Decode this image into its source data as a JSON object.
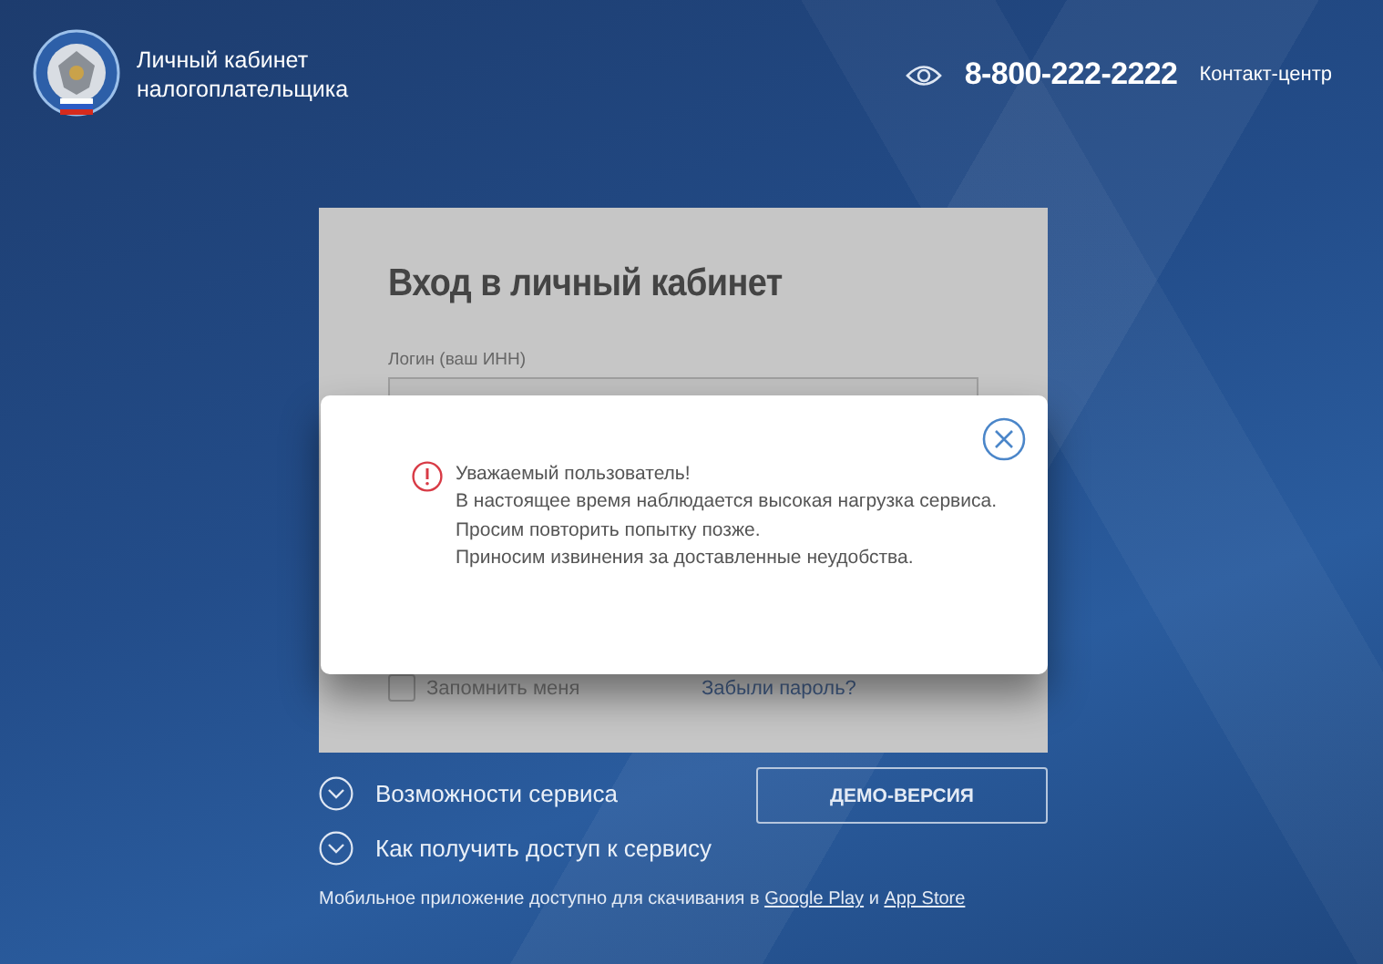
{
  "header": {
    "title_lines": [
      "Личный кабинет",
      "налогоплательщика"
    ],
    "phone": "8-800-222-2222",
    "contact_label": "Контакт-центр"
  },
  "login_card": {
    "title": "Вход в личный кабинет",
    "login_label": "Логин (ваш ИНН)",
    "remember": {
      "label": "Запомнить меня",
      "checked": false
    },
    "forgot_link": "Забыли пароль?"
  },
  "dialog": {
    "lines": [
      "Уважаемый пользователь!",
      "В настоящее время наблюдается высокая нагрузка сервиса.",
      "Просим повторить попытку позже.",
      "Приносим извинения за доставленные неудобства."
    ]
  },
  "expanders": [
    {
      "label": "Возможности сервиса",
      "expanded": false
    },
    {
      "label": "Как получить доступ к сервису",
      "expanded": false
    }
  ],
  "demo_button": "ДЕМО-ВЕРСИЯ",
  "footer": {
    "text": "Мобильное приложение доступно для скачивания в",
    "google_play": "Google Play",
    "conjunction": "и",
    "app_store": "App Store"
  }
}
